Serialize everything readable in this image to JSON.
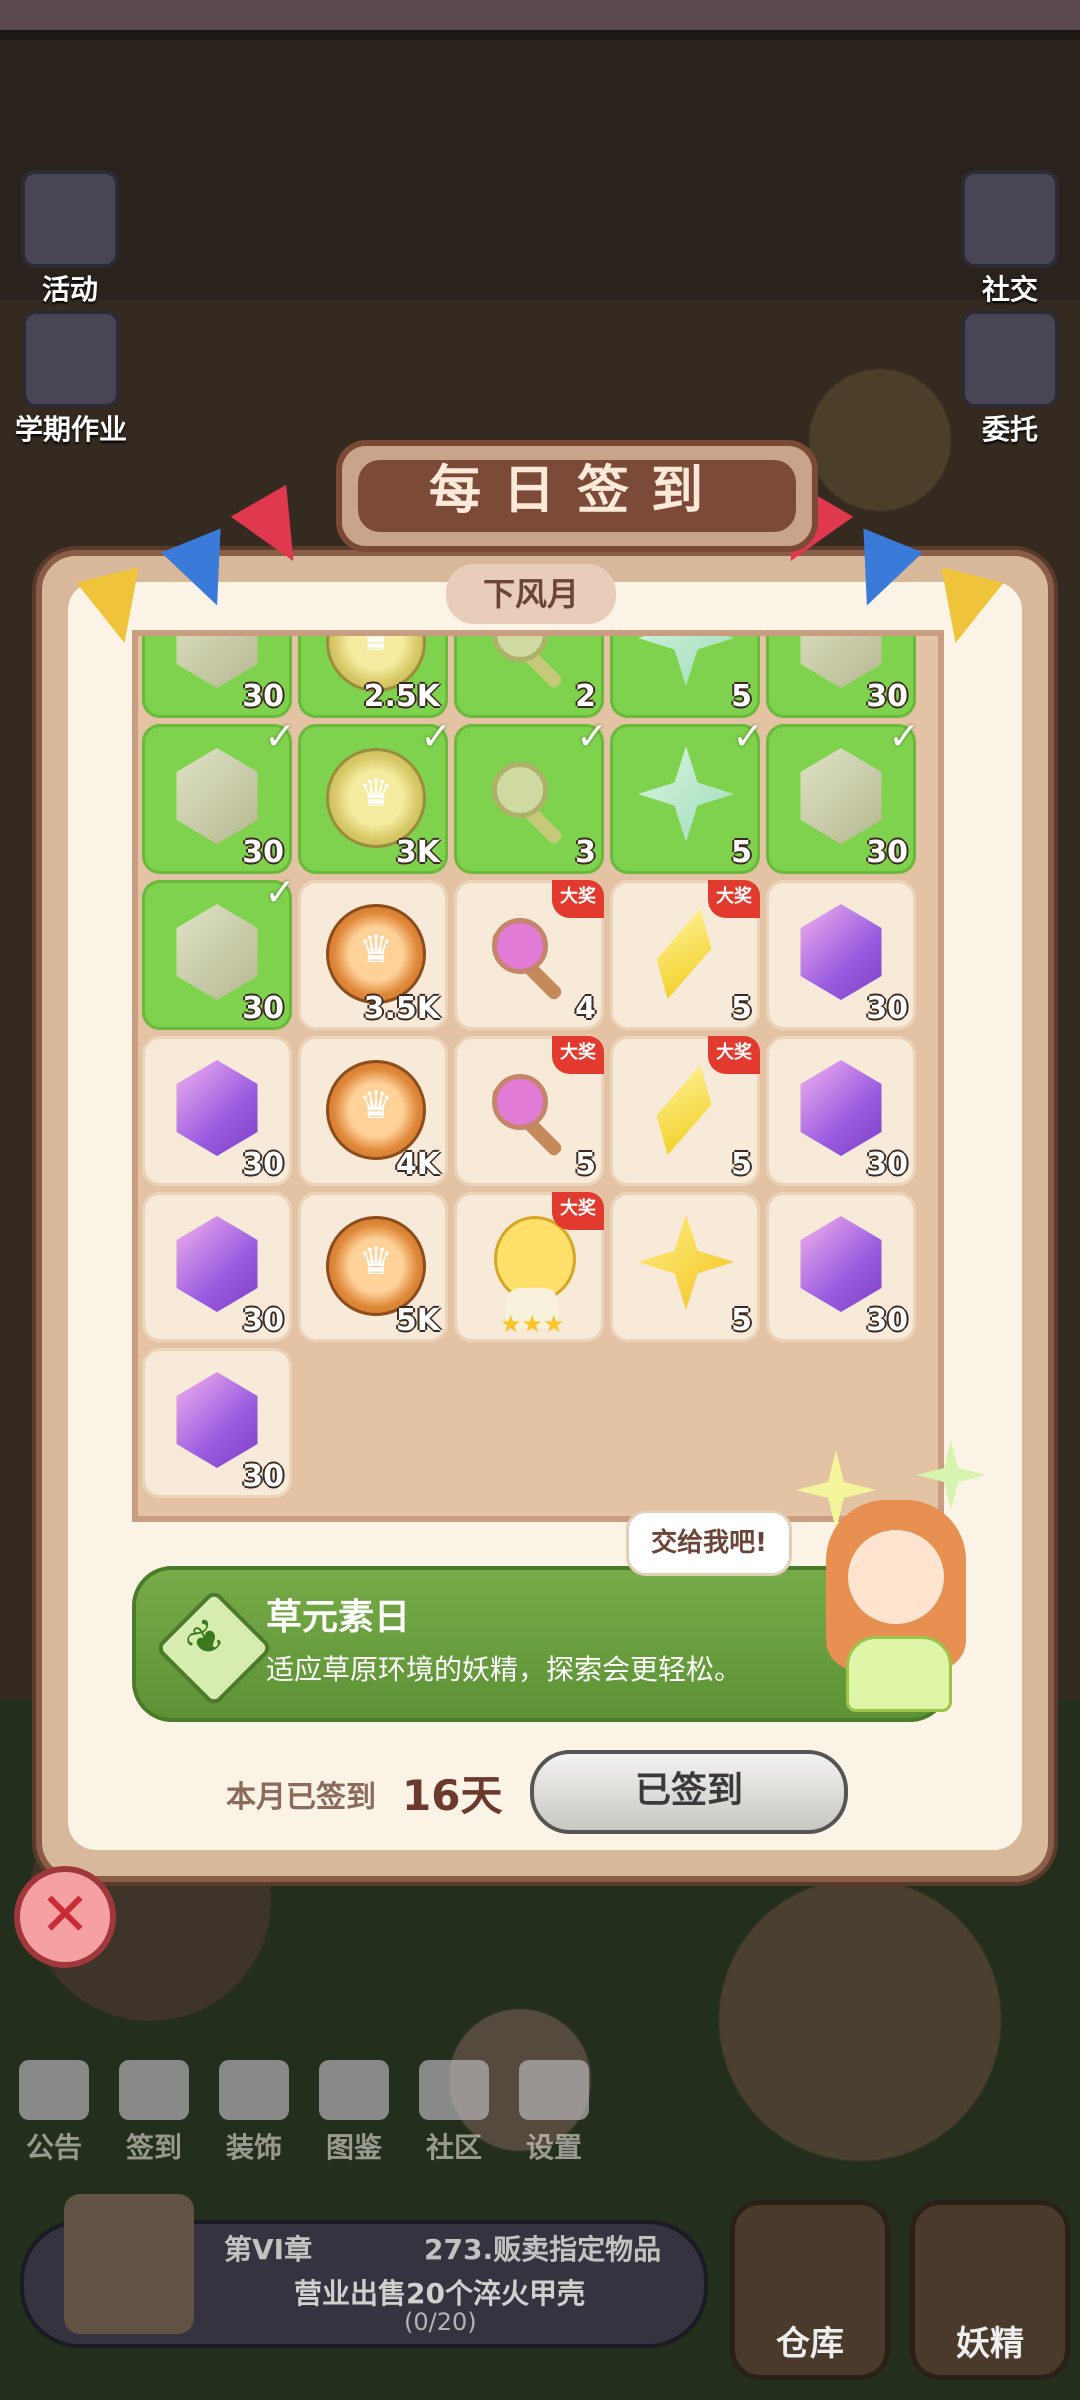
{
  "modal": {
    "title": "每日签到",
    "month": "下风月",
    "signed_label": "本月已签到",
    "signed_days": "16天",
    "signed_button": "已签到",
    "speech": "交给我吧!",
    "big_prize_label": "大奖",
    "info": {
      "title": "草元素日",
      "description": "适应草原环境的妖精，探索会更轻松。"
    }
  },
  "side_left": [
    {
      "label": "活动",
      "icon": "activity-icon"
    },
    {
      "label": "学期作业",
      "icon": "homework-icon"
    }
  ],
  "side_right": [
    {
      "label": "社交",
      "icon": "social-icon"
    },
    {
      "label": "委托",
      "icon": "commission-icon"
    }
  ],
  "bottom_nav": [
    {
      "label": "公告",
      "icon": "announcement-icon"
    },
    {
      "label": "签到",
      "icon": "checkin-icon"
    },
    {
      "label": "装饰",
      "icon": "decoration-icon"
    },
    {
      "label": "图鉴",
      "icon": "catalog-icon"
    },
    {
      "label": "社区",
      "icon": "community-icon"
    },
    {
      "label": "设置",
      "icon": "settings-icon"
    }
  ],
  "quest": {
    "chapter": "第VI章",
    "quest_name": "273.贩卖指定物品",
    "task": "营业出售20个淬火甲壳",
    "progress": "(0/20)"
  },
  "corner_buttons": {
    "warehouse": "仓库",
    "fairy": "妖精"
  },
  "rewards": [
    {
      "qty": "30",
      "item": "gem",
      "state": "claimed"
    },
    {
      "qty": "2.5K",
      "item": "coin",
      "state": "claimed"
    },
    {
      "qty": "2",
      "item": "key",
      "state": "claimed"
    },
    {
      "qty": "5",
      "item": "star",
      "state": "claimed"
    },
    {
      "qty": "30",
      "item": "gem",
      "state": "claimed"
    },
    {
      "qty": "30",
      "item": "gem",
      "state": "claimed"
    },
    {
      "qty": "3K",
      "item": "coin",
      "state": "claimed"
    },
    {
      "qty": "3",
      "item": "key",
      "state": "claimed"
    },
    {
      "qty": "5",
      "item": "star",
      "state": "claimed"
    },
    {
      "qty": "30",
      "item": "gem",
      "state": "claimed"
    },
    {
      "qty": "30",
      "item": "gem",
      "state": "claimed"
    },
    {
      "qty": "3.5K",
      "item": "coin",
      "state": "open"
    },
    {
      "qty": "4",
      "item": "key",
      "state": "open",
      "big": true
    },
    {
      "qty": "5",
      "item": "crystal",
      "state": "open",
      "big": true
    },
    {
      "qty": "30",
      "item": "gem",
      "state": "open"
    },
    {
      "qty": "30",
      "item": "gem",
      "state": "open"
    },
    {
      "qty": "4K",
      "item": "coin",
      "state": "open"
    },
    {
      "qty": "5",
      "item": "key",
      "state": "open",
      "big": true
    },
    {
      "qty": "5",
      "item": "crystal",
      "state": "open",
      "big": true
    },
    {
      "qty": "30",
      "item": "gem",
      "state": "open"
    },
    {
      "qty": "30",
      "item": "gem",
      "state": "open"
    },
    {
      "qty": "5K",
      "item": "coin",
      "state": "open"
    },
    {
      "qty": "",
      "item": "fairy",
      "state": "open",
      "big": true
    },
    {
      "qty": "5",
      "item": "star",
      "state": "open"
    },
    {
      "qty": "30",
      "item": "gem",
      "state": "open"
    },
    {
      "qty": "30",
      "item": "gem",
      "state": "open"
    }
  ]
}
